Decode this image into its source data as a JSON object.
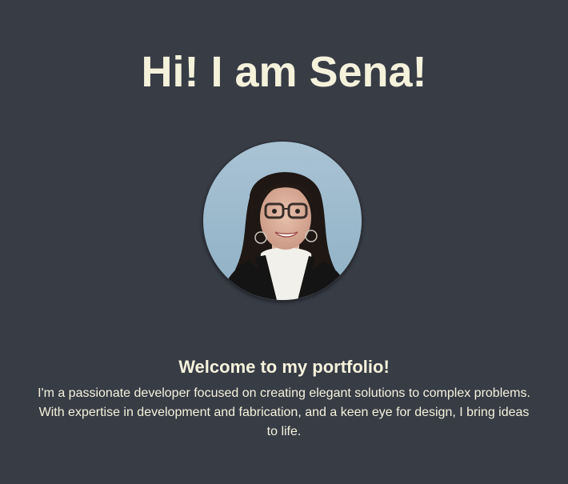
{
  "hero": {
    "title": "Hi! I am Sena!"
  },
  "profile": {
    "photo_alt": "Portrait photo of Sena"
  },
  "welcome": {
    "heading": "Welcome to my portfolio!",
    "intro": "I'm a passionate developer focused on creating elegant solutions to complex problems. With expertise in development and fabrication, and a keen eye for design, I bring ideas to life."
  },
  "colors": {
    "background": "#383c45",
    "text": "#f5f2dc"
  }
}
